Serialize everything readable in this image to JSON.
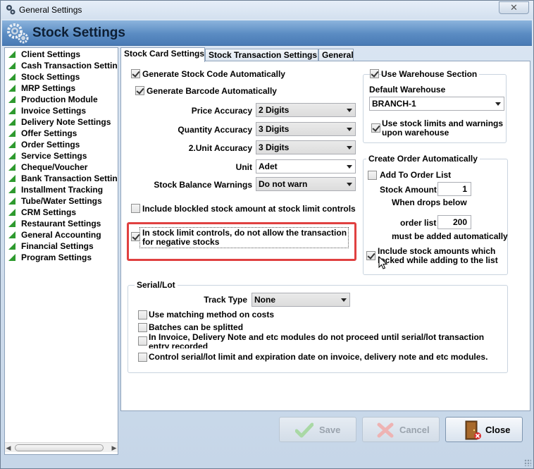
{
  "window": {
    "title": "General Settings",
    "close_glyph": "✕"
  },
  "header": {
    "title": "Stock Settings"
  },
  "sidebar": {
    "items": [
      "Client Settings",
      "Cash Transaction Settings",
      "Stock Settings",
      "MRP Settings",
      "Production Module",
      "Invoice Settings",
      "Delivery Note Settings",
      "Offer Settings",
      "Order Settings",
      "Service Settings",
      "Cheque/Voucher",
      "Bank Transaction Settings",
      "Installment Tracking",
      "Tube/Water Settings",
      "CRM Settings",
      "Restaurant Settings",
      "General Accounting",
      "Financial Settings",
      "Program Settings"
    ],
    "triangle_color": "#2e9a2e"
  },
  "tabs": {
    "stock_card": "Stock Card Settings",
    "stock_transaction": "Stock Transaction Settings",
    "general": "General"
  },
  "stock_card": {
    "generate_stock_code": {
      "label": "Generate Stock Code Automatically",
      "checked": true
    },
    "generate_barcode": {
      "label": "Generate Barcode Automatically",
      "checked": true
    },
    "price_accuracy": {
      "label": "Price Accuracy",
      "value": "2 Digits"
    },
    "quantity_accuracy": {
      "label": "Quantity Accuracy",
      "value": "3 Digits"
    },
    "unit2_accuracy": {
      "label": "2.Unit Accuracy",
      "value": "3 Digits"
    },
    "unit": {
      "label": "Unit",
      "value": "Adet"
    },
    "stock_balance_warnings": {
      "label": "Stock Balance Warnings",
      "value": "Do not warn"
    },
    "include_blocked": {
      "label": "Include blockled stock amount at stock limit controls",
      "checked": false
    },
    "no_negative_line1": "In stock limit controls, do not allow the transaction",
    "no_negative_line2": "for negative stocks",
    "no_negative_checked": true
  },
  "warehouse": {
    "use_section": {
      "label": "Use Warehouse Section",
      "checked": true
    },
    "default_label": "Default Warehouse",
    "default_value": "BRANCH-1",
    "limits_line1": "Use stock limits and warnings",
    "limits_line2": "upon warehouse",
    "limits_checked": true
  },
  "create_order": {
    "title": "Create Order Automatically",
    "add_to_list": {
      "label": "Add To Order List",
      "checked": false
    },
    "stock_amount_label": "Stock Amount",
    "stock_amount_value": "1",
    "when_drops": "When drops below",
    "order_list_label": "order list",
    "order_list_value": "200",
    "must_be_added": "must be added automatically",
    "include_locked_line1": "Include stock amounts which",
    "include_locked_line2": "locked while adding to the list",
    "include_locked_checked": true
  },
  "serial_lot": {
    "title": "Serial/Lot",
    "track_type_label": "Track Type",
    "track_type_value": "None",
    "matching_method": "Use matching method on costs",
    "batches_split": "Batches can be splitted",
    "invoice_line1": "In Invoice, Delivery Note and etc modules do not proceed until serial/lot transaction",
    "invoice_line2": "entry recorded",
    "control_limit": "Control serial/lot limit and expiration date on invoice, delivery note and etc modules."
  },
  "buttons": {
    "save": "Save",
    "cancel": "Cancel",
    "close": "Close"
  },
  "colors": {
    "highlight": "#e04040",
    "header": "#5a8bc2"
  }
}
